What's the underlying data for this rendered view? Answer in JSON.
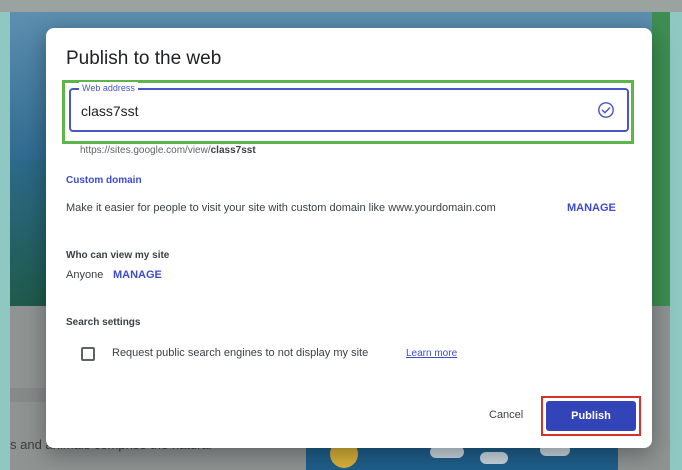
{
  "background": {
    "page_text": "s and animals comprise the natural"
  },
  "dialog": {
    "title": "Publish to the web",
    "web_address": {
      "legend": "Web address",
      "value": "class7sst",
      "hint_prefix": "https://sites.google.com/view/",
      "hint_site": "class7sst",
      "status_icon": "check-circle-icon"
    },
    "custom_domain": {
      "label": "Custom domain",
      "description": "Make it easier for people to visit your site with custom domain like www.yourdomain.com",
      "manage_label": "MANAGE"
    },
    "who_can_view": {
      "label": "Who can view my site",
      "value": "Anyone",
      "manage_label": "MANAGE"
    },
    "search_settings": {
      "label": "Search settings",
      "checkbox_label": "Request public search engines to not display my site",
      "checked": false,
      "learn_more": "Learn more"
    },
    "buttons": {
      "cancel": "Cancel",
      "publish": "Publish"
    }
  },
  "colors": {
    "accent": "#3344b8",
    "link": "#3c4bd0",
    "highlight_green": "#5bb54a",
    "highlight_red": "#d6312b"
  }
}
